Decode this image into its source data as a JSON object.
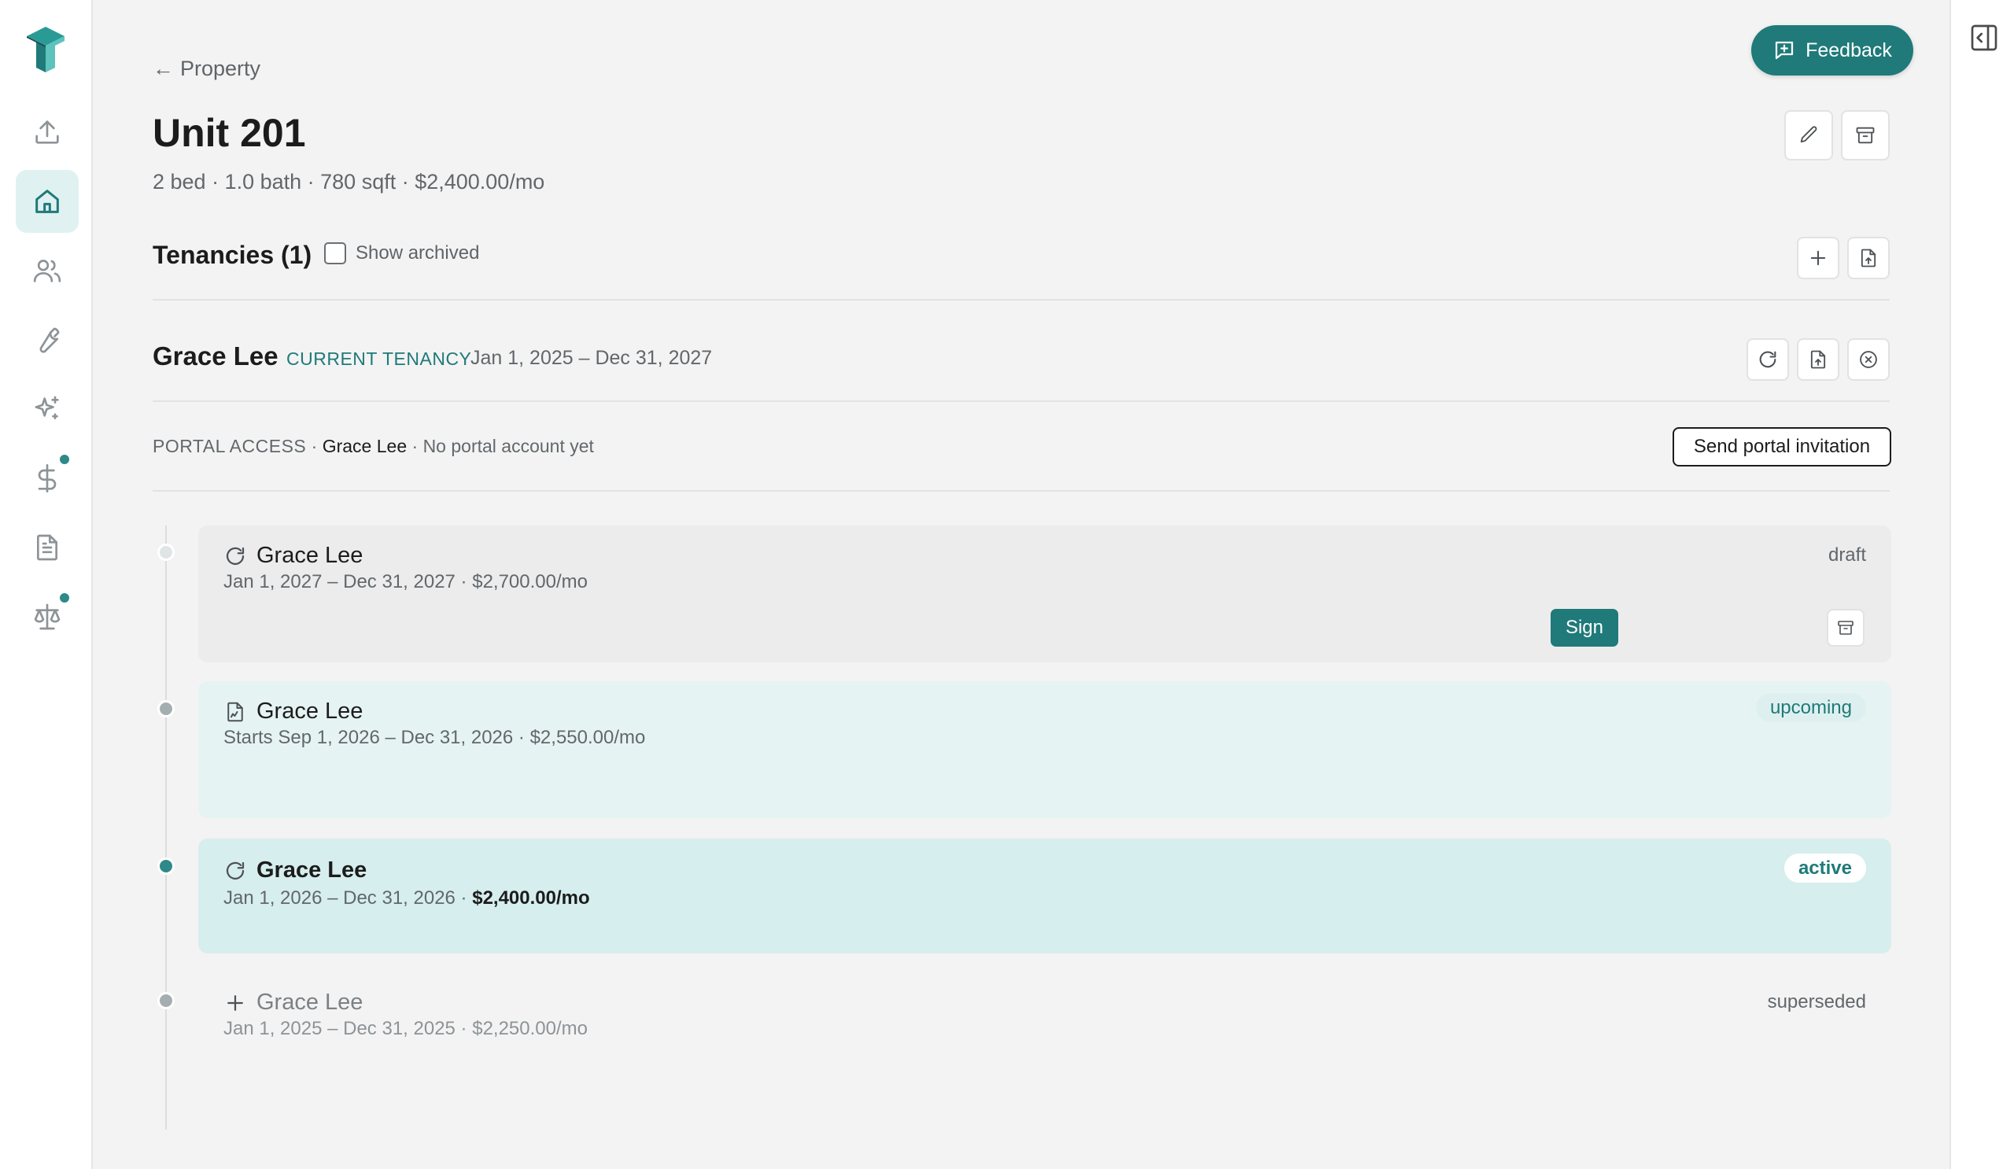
{
  "header": {
    "back_label": "Property",
    "title": "Unit 201",
    "subtitle": "2 bed · 1.0 bath · 780 sqft · $2,400.00/mo",
    "feedback_label": "Feedback"
  },
  "sidebar": {
    "items": [
      {
        "name": "upload-icon",
        "active": false
      },
      {
        "name": "home-icon",
        "active": true
      },
      {
        "name": "users-icon",
        "active": false
      },
      {
        "name": "wrench-icon",
        "active": false
      },
      {
        "name": "sparkles-icon",
        "active": false
      },
      {
        "name": "dollar-icon",
        "active": false,
        "badge": true
      },
      {
        "name": "document-icon",
        "active": false
      },
      {
        "name": "scale-icon",
        "active": false,
        "badge": true
      }
    ]
  },
  "tenancies": {
    "title": "Tenancies (1)",
    "show_archived_label": "Show archived",
    "show_archived_checked": false
  },
  "current": {
    "tenant": "Grace Lee",
    "tag": "CURRENT TENANCY",
    "dates": "Jan 1, 2025 – Dec 31, 2027"
  },
  "portal": {
    "label": "PORTAL ACCESS",
    "sep1": " · ",
    "tenant": "Grace Lee",
    "status": " · No portal account yet",
    "invite_label": "Send portal invitation"
  },
  "leases": [
    {
      "icon": "refresh-icon",
      "tenant": "Grace Lee",
      "details": "Jan 1, 2027 – Dec 31, 2027 · $2,700.00/mo",
      "status": "draft",
      "sign_label": "Sign"
    },
    {
      "icon": "file-signature-icon",
      "tenant": "Grace Lee",
      "details": "Starts Sep 1, 2026 – Dec 31, 2026 · $2,550.00/mo",
      "status": "upcoming"
    },
    {
      "icon": "refresh-icon",
      "tenant": "Grace Lee",
      "dates": "Jan 1, 2026 – Dec 31, 2026 · ",
      "rent": "$2,400.00/mo",
      "status": "active"
    },
    {
      "icon": "plus-icon",
      "tenant": "Grace Lee",
      "details": "Jan 1, 2025 – Dec 31, 2025 · $2,250.00/mo",
      "status": "superseded"
    }
  ],
  "colors": {
    "accent": "#1f7a79",
    "accent_light": "#e0f1f1",
    "background": "#f3f3f3"
  }
}
